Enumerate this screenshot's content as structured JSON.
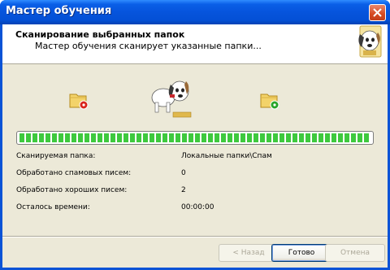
{
  "window": {
    "title": "Мастер обучения"
  },
  "header": {
    "title": "Сканирование выбранных папок",
    "subtitle": "Мастер обучения сканирует указанные папки..."
  },
  "progress": {
    "fraction": 1.0,
    "color": "#3ec93e"
  },
  "info": {
    "rows": [
      {
        "label": "Сканируемая папка:",
        "value": "Локальные папки\\Спам"
      },
      {
        "label": "Обработано спамовых писем:",
        "value": "0"
      },
      {
        "label": "Обработано хороших писем:",
        "value": "2"
      },
      {
        "label": "Осталось времени:",
        "value": "00:00:00"
      }
    ]
  },
  "buttons": {
    "back": "< Назад",
    "finish": "Готово",
    "cancel": "Отмена"
  },
  "icons": {
    "logo": "dog-logo-icon",
    "source_folder": "spam-folder-icon",
    "dest_folder": "good-folder-icon",
    "animation": "dog-animation-icon"
  }
}
